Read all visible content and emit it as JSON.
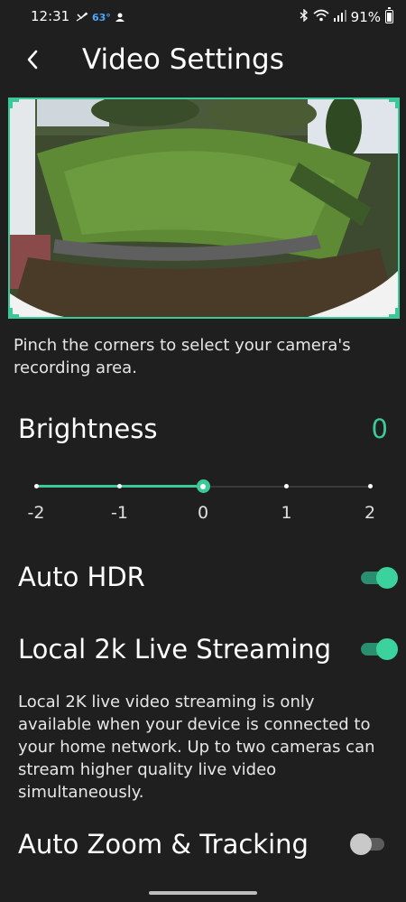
{
  "status_bar": {
    "time": "12:31",
    "temperature": "63°",
    "battery": "91%"
  },
  "header": {
    "title": "Video Settings",
    "back_icon": "chevron-left-icon"
  },
  "preview": {
    "hint": "Pinch the corners to select your camera's recording area.",
    "border_color": "#3cc99a"
  },
  "brightness": {
    "label": "Brightness",
    "value": "0",
    "ticks": [
      "-2",
      "-1",
      "0",
      "1",
      "2"
    ],
    "selected_index": 2
  },
  "auto_hdr": {
    "label": "Auto HDR",
    "enabled": true
  },
  "local_streaming": {
    "label": "Local 2k Live Streaming",
    "enabled": true,
    "description": "Local 2K live video streaming is only available when your device is connected to your home network. Up to two cameras can stream higher quality live video simultaneously."
  },
  "auto_zoom": {
    "label": "Auto Zoom & Tracking",
    "enabled": false
  },
  "colors": {
    "accent": "#3cc99a",
    "background": "#1f1f1f"
  }
}
